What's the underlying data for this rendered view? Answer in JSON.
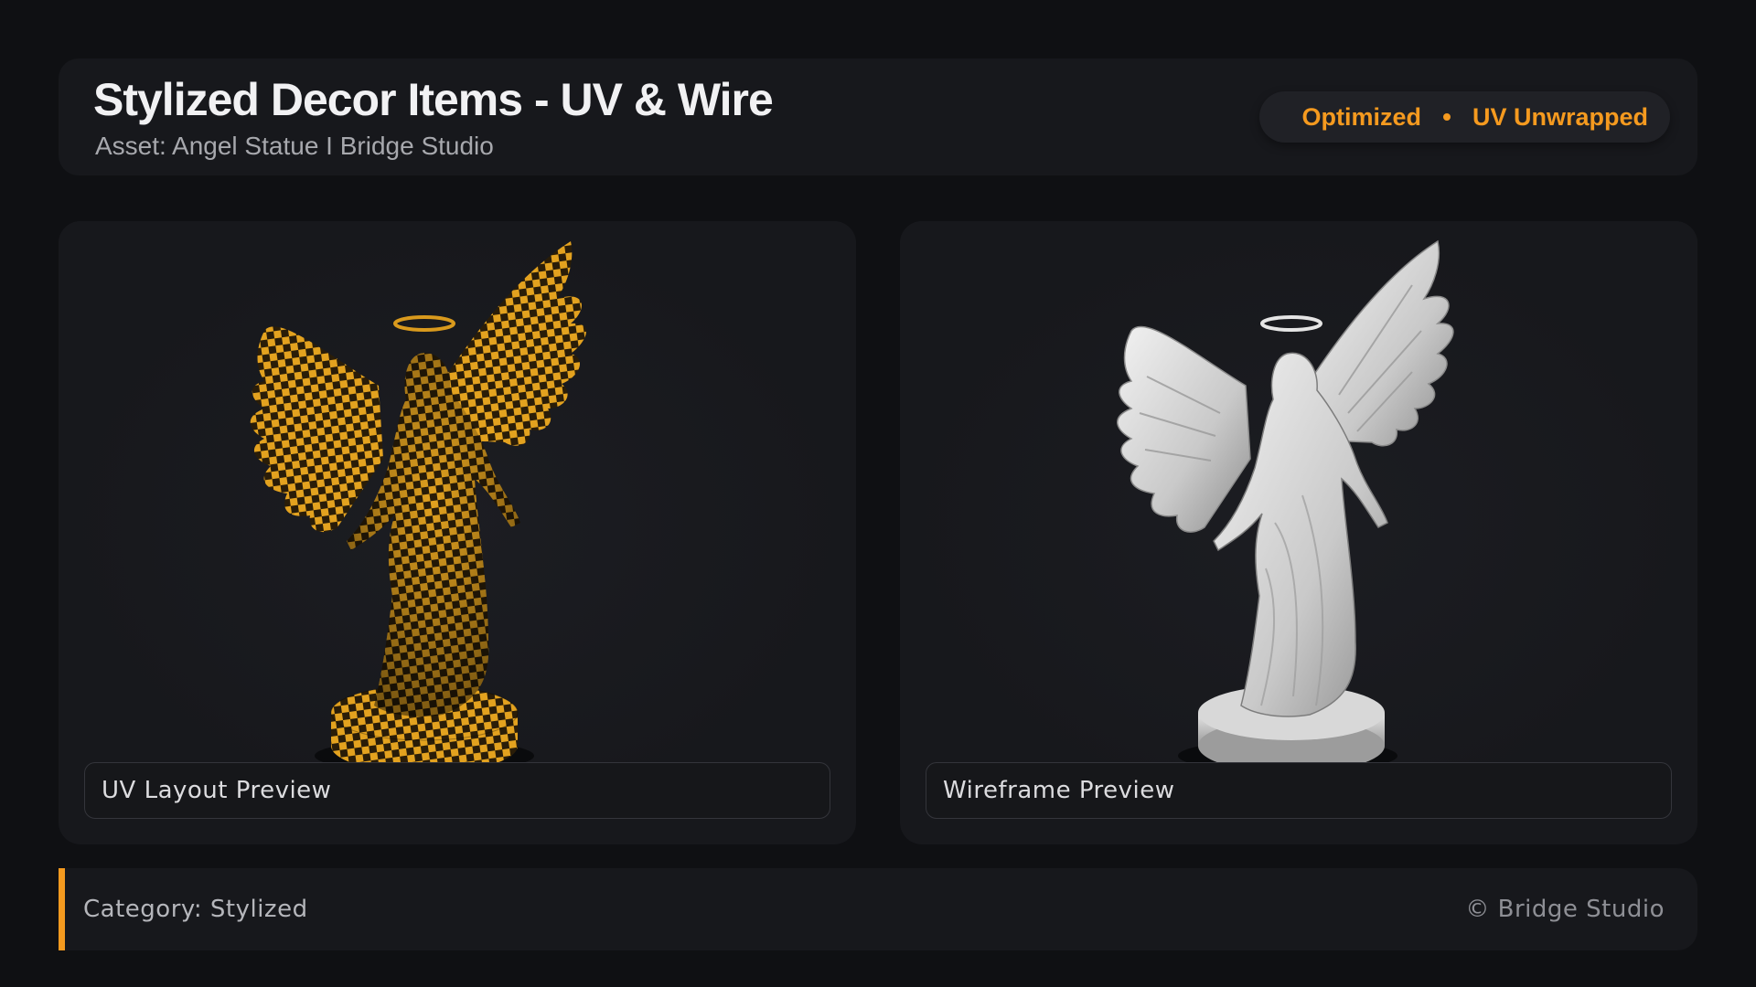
{
  "header": {
    "title": "Stylized Decor Items - UV & Wire",
    "subtitle": "Asset: Angel Statue  I  Bridge Studio",
    "tags": [
      "Optimized",
      "UV Unwrapped"
    ],
    "accent_color": "#f59a1f"
  },
  "previews": [
    {
      "caption": "UV Layout Preview",
      "style": "checker",
      "icon": "angel-statue-uv-checker"
    },
    {
      "caption": "Wireframe Preview",
      "style": "white",
      "icon": "angel-statue-wireframe"
    }
  ],
  "footer": {
    "category": "Category: Stylized",
    "copyright": "© Bridge Studio"
  }
}
